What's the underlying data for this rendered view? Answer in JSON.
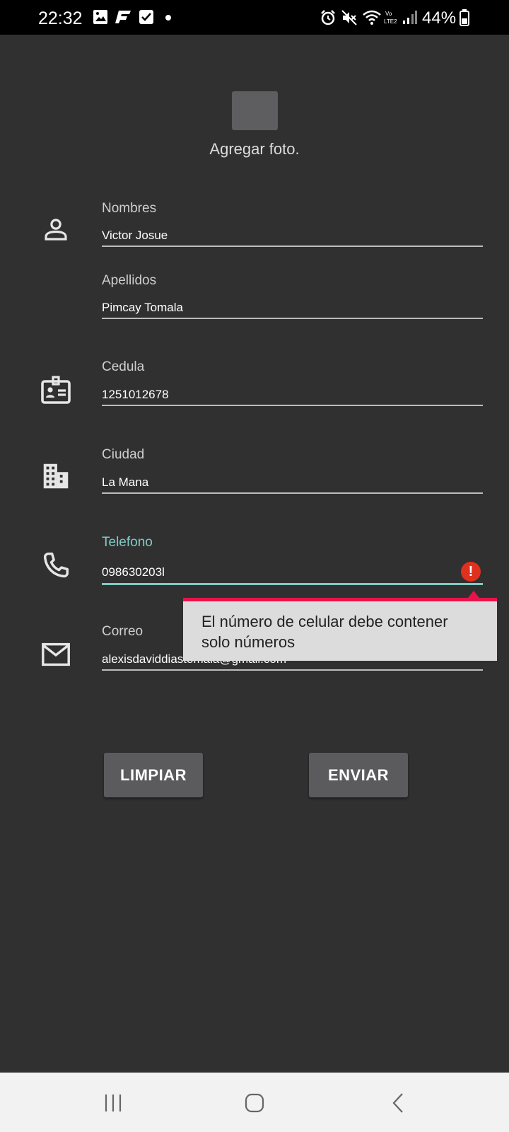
{
  "status_bar": {
    "time": "22:32",
    "battery": "44%",
    "icons": [
      "image-icon",
      "app-f-icon",
      "checkbox-icon",
      "dot-icon",
      "alarm-icon",
      "mute-icon",
      "wifi-icon",
      "volte-icon",
      "signal-icon",
      "battery-icon"
    ]
  },
  "photo": {
    "label": "Agregar foto."
  },
  "fields": {
    "nombres": {
      "label": "Nombres",
      "value": "Victor Josue",
      "icon": "person-icon"
    },
    "apellidos": {
      "label": "Apellidos",
      "value": "Pimcay Tomala"
    },
    "cedula": {
      "label": "Cedula",
      "value": "1251012678",
      "icon": "id-card-icon"
    },
    "ciudad": {
      "label": "Ciudad",
      "value": "La Mana",
      "icon": "city-icon"
    },
    "telefono": {
      "label": "Telefono",
      "value": "098630203l",
      "icon": "phone-icon",
      "error": "El número de celular debe contener solo números"
    },
    "correo": {
      "label": "Correo",
      "value": "alexisdaviddiastomala@gmail.com",
      "icon": "mail-icon"
    }
  },
  "buttons": {
    "clear": "LIMPIAR",
    "send": "ENVIAR"
  },
  "colors": {
    "background": "#303030",
    "accent": "#80cbc4",
    "error": "#e0301e",
    "error_bar": "#e8134b",
    "button": "#5b5b5d"
  }
}
